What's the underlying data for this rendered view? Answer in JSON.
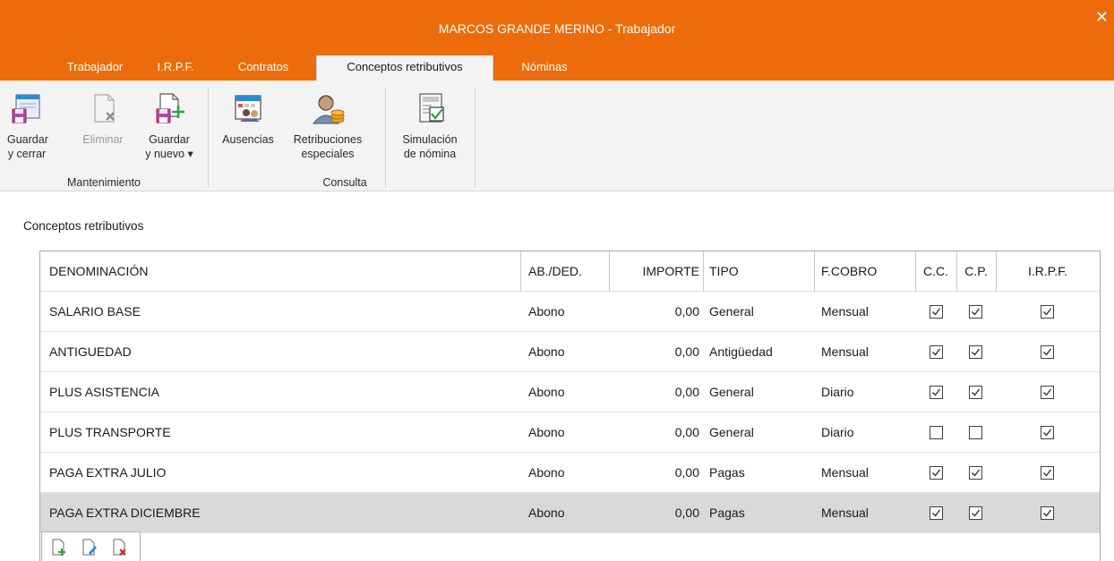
{
  "window": {
    "title": "MARCOS GRANDE MERINO - Trabajador",
    "close_glyph": "✕"
  },
  "tabs": [
    {
      "label": "Trabajador"
    },
    {
      "label": "I.R.P.F."
    },
    {
      "label": "Contratos"
    },
    {
      "label": "Conceptos retributivos",
      "active": true
    },
    {
      "label": "Nóminas"
    }
  ],
  "ribbon": {
    "groups": {
      "mantenimiento": "Mantenimiento",
      "consulta": "Consulta"
    },
    "buttons": {
      "guardar_cerrar": [
        "Guardar",
        "y cerrar"
      ],
      "eliminar": [
        "Eliminar"
      ],
      "guardar_nuevo": [
        "Guardar",
        "y nuevo ▾"
      ],
      "ausencias": [
        "Ausencias"
      ],
      "retribuciones": [
        "Retribuciones",
        "especiales"
      ],
      "simulacion": [
        "Simulación",
        "de nómina"
      ]
    }
  },
  "section_label": "Conceptos retributivos",
  "table": {
    "columns": {
      "denominacion": "DENOMINACIÓN",
      "abded": "AB./DED.",
      "importe": "IMPORTE",
      "tipo": "TIPO",
      "fcobro": "F.COBRO",
      "cc": "C.C.",
      "cp": "C.P.",
      "irpf": "I.R.P.F."
    },
    "rows": [
      {
        "denominacion": "SALARIO BASE",
        "abded": "Abono",
        "importe": "0,00",
        "tipo": "General",
        "fcobro": "Mensual",
        "cc": true,
        "cp": true,
        "irpf": true
      },
      {
        "denominacion": "ANTIGUEDAD",
        "abded": "Abono",
        "importe": "0,00",
        "tipo": "Antigüedad",
        "fcobro": "Mensual",
        "cc": true,
        "cp": true,
        "irpf": true
      },
      {
        "denominacion": "PLUS ASISTENCIA",
        "abded": "Abono",
        "importe": "0,00",
        "tipo": "General",
        "fcobro": "Diario",
        "cc": true,
        "cp": true,
        "irpf": true
      },
      {
        "denominacion": "PLUS TRANSPORTE",
        "abded": "Abono",
        "importe": "0,00",
        "tipo": "General",
        "fcobro": "Diario",
        "cc": false,
        "cp": false,
        "irpf": true
      },
      {
        "denominacion": "PAGA EXTRA JULIO",
        "abded": "Abono",
        "importe": "0,00",
        "tipo": "Pagas",
        "fcobro": "Mensual",
        "cc": true,
        "cp": true,
        "irpf": true
      },
      {
        "denominacion": "PAGA EXTRA DICIEMBRE",
        "abded": "Abono",
        "importe": "0,00",
        "tipo": "Pagas",
        "fcobro": "Mensual",
        "cc": true,
        "cp": true,
        "irpf": true,
        "selected": true
      }
    ]
  },
  "colors": {
    "accent": "#ec6c0c",
    "ribbon_bg": "#f3f3f3",
    "selected_row": "#d9d9d9"
  },
  "icons": {
    "ribbon": [
      "save-close-icon",
      "delete-icon",
      "save-new-icon",
      "absences-icon",
      "special-payments-icon",
      "payroll-simulation-icon"
    ],
    "grid_nav": [
      "add-row-icon",
      "edit-row-icon",
      "delete-row-icon"
    ]
  }
}
